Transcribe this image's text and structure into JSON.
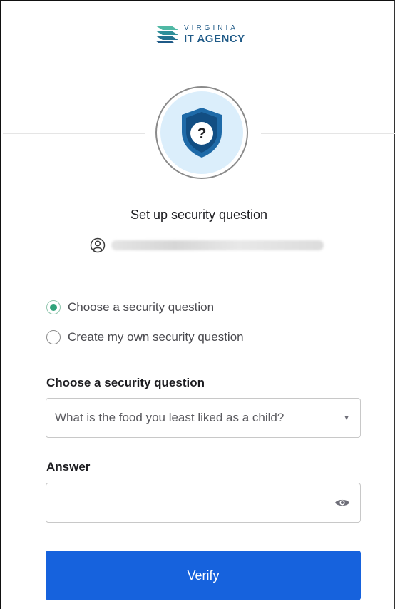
{
  "brand": {
    "logo_top": "VIRGINIA",
    "logo_bottom": "IT AGENCY",
    "logo_icon": "stacked-chevrons-logo",
    "color": "#1f5a87"
  },
  "badge": {
    "icon": "shield-question-icon",
    "glyph": "?",
    "shield_color": "#1e6aa8",
    "ring_fill": "#dbeefb"
  },
  "title": "Set up security question",
  "user": {
    "icon": "user-circle-icon",
    "identifier_blurred": true
  },
  "options": [
    {
      "label": "Choose a security question",
      "checked": true
    },
    {
      "label": "Create my own security question",
      "checked": false
    }
  ],
  "question_field": {
    "label": "Choose a security question",
    "value": "What is the food you least liked as a child?",
    "caret_icon": "chevron-down-icon"
  },
  "answer_field": {
    "label": "Answer",
    "value": "",
    "toggle_icon": "eye-icon"
  },
  "verify_label": "Verify",
  "colors": {
    "accent": "#1662dd",
    "radio_selected": "#2fa37a"
  }
}
